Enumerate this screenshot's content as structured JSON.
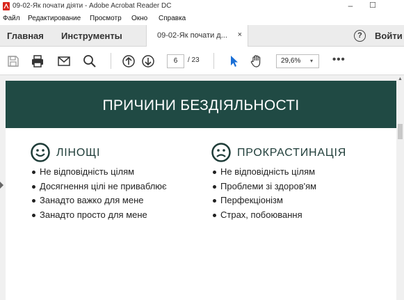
{
  "window": {
    "title": "09-02-Як почати діяти - Adobe Acrobat Reader DC",
    "controls": {
      "minimize": "–",
      "maximize": "☐"
    }
  },
  "menu": [
    "Файл",
    "Редактирование",
    "Просмотр",
    "Окно",
    "Справка"
  ],
  "tabs": {
    "home": "Главная",
    "tools": "Инструменты",
    "document": "09-02-Як почати д...",
    "close": "×",
    "help": "?",
    "signin": "Войти"
  },
  "toolbar": {
    "page_current": "6",
    "page_total": "/ 23",
    "zoom": "29,6%",
    "zoom_caret": "▾",
    "more": "•••"
  },
  "document": {
    "banner_title": "ПРИЧИНИ БЕЗДІЯЛЬНОСТІ",
    "banner_color": "#204a44",
    "left": {
      "heading": "ЛІНОЩІ",
      "icon": "smiley-happy-icon",
      "items": [
        "Не відповідність цілям",
        "Досягнення цілі не приваблює",
        "Занадто важко для мене",
        "Занадто просто для мене"
      ]
    },
    "right": {
      "heading": "ПРОКРАСТИНАЦІЯ",
      "icon": "smiley-sad-icon",
      "items": [
        "Не відповідність цілям",
        "Проблеми зі здоров'ям",
        "Перфекціонізм",
        "Страх, побоювання"
      ]
    }
  },
  "colors": {
    "accent_blue": "#1a6fd6",
    "banner": "#204a44",
    "acrobat_red": "#d9261c"
  }
}
